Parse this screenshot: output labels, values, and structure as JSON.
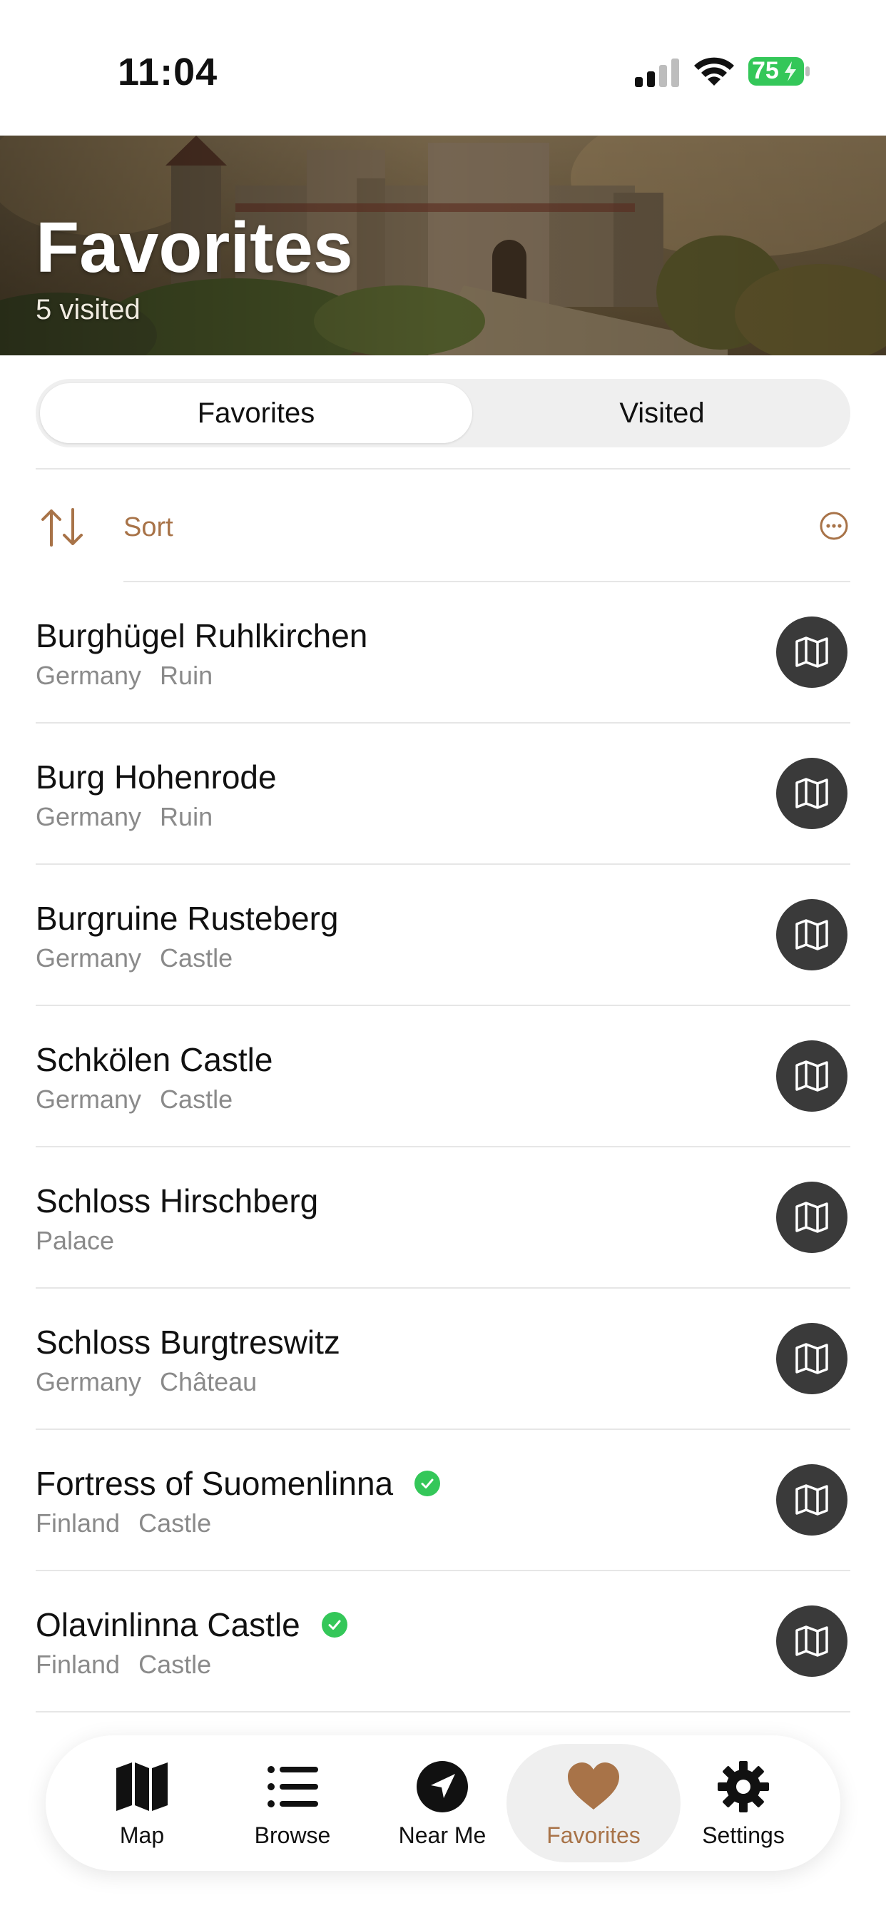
{
  "status_bar": {
    "time": "11:04",
    "battery": "75"
  },
  "header": {
    "title": "Favorites",
    "subtitle": "5 visited"
  },
  "segments": {
    "active": "Favorites",
    "inactive": "Visited"
  },
  "sort": {
    "label": "Sort"
  },
  "items": [
    {
      "name": "Burghügel Ruhlkirchen",
      "country": "Germany",
      "type": "Ruin",
      "visited": false
    },
    {
      "name": "Burg Hohenrode",
      "country": "Germany",
      "type": "Ruin",
      "visited": false
    },
    {
      "name": "Burgruine Rusteberg",
      "country": "Germany",
      "type": "Castle",
      "visited": false
    },
    {
      "name": "Schkölen Castle",
      "country": "Germany",
      "type": "Castle",
      "visited": false
    },
    {
      "name": "Schloss Hirschberg",
      "country": "",
      "type": "Palace",
      "visited": false
    },
    {
      "name": "Schloss Burgtreswitz",
      "country": "Germany",
      "type": "Château",
      "visited": false
    },
    {
      "name": "Fortress of Suomenlinna",
      "country": "Finland",
      "type": "Castle",
      "visited": true
    },
    {
      "name": "Olavinlinna Castle",
      "country": "Finland",
      "type": "Castle",
      "visited": true
    }
  ],
  "tabs": [
    {
      "label": "Map",
      "icon": "map-icon"
    },
    {
      "label": "Browse",
      "icon": "list-icon"
    },
    {
      "label": "Near Me",
      "icon": "location-arrow-icon"
    },
    {
      "label": "Favorites",
      "icon": "heart-icon",
      "active": true
    },
    {
      "label": "Settings",
      "icon": "gear-icon"
    }
  ],
  "colors": {
    "accent": "#a87348",
    "visited_check": "#34c759",
    "map_button": "#3a3a3a",
    "battery": "#34c759"
  }
}
